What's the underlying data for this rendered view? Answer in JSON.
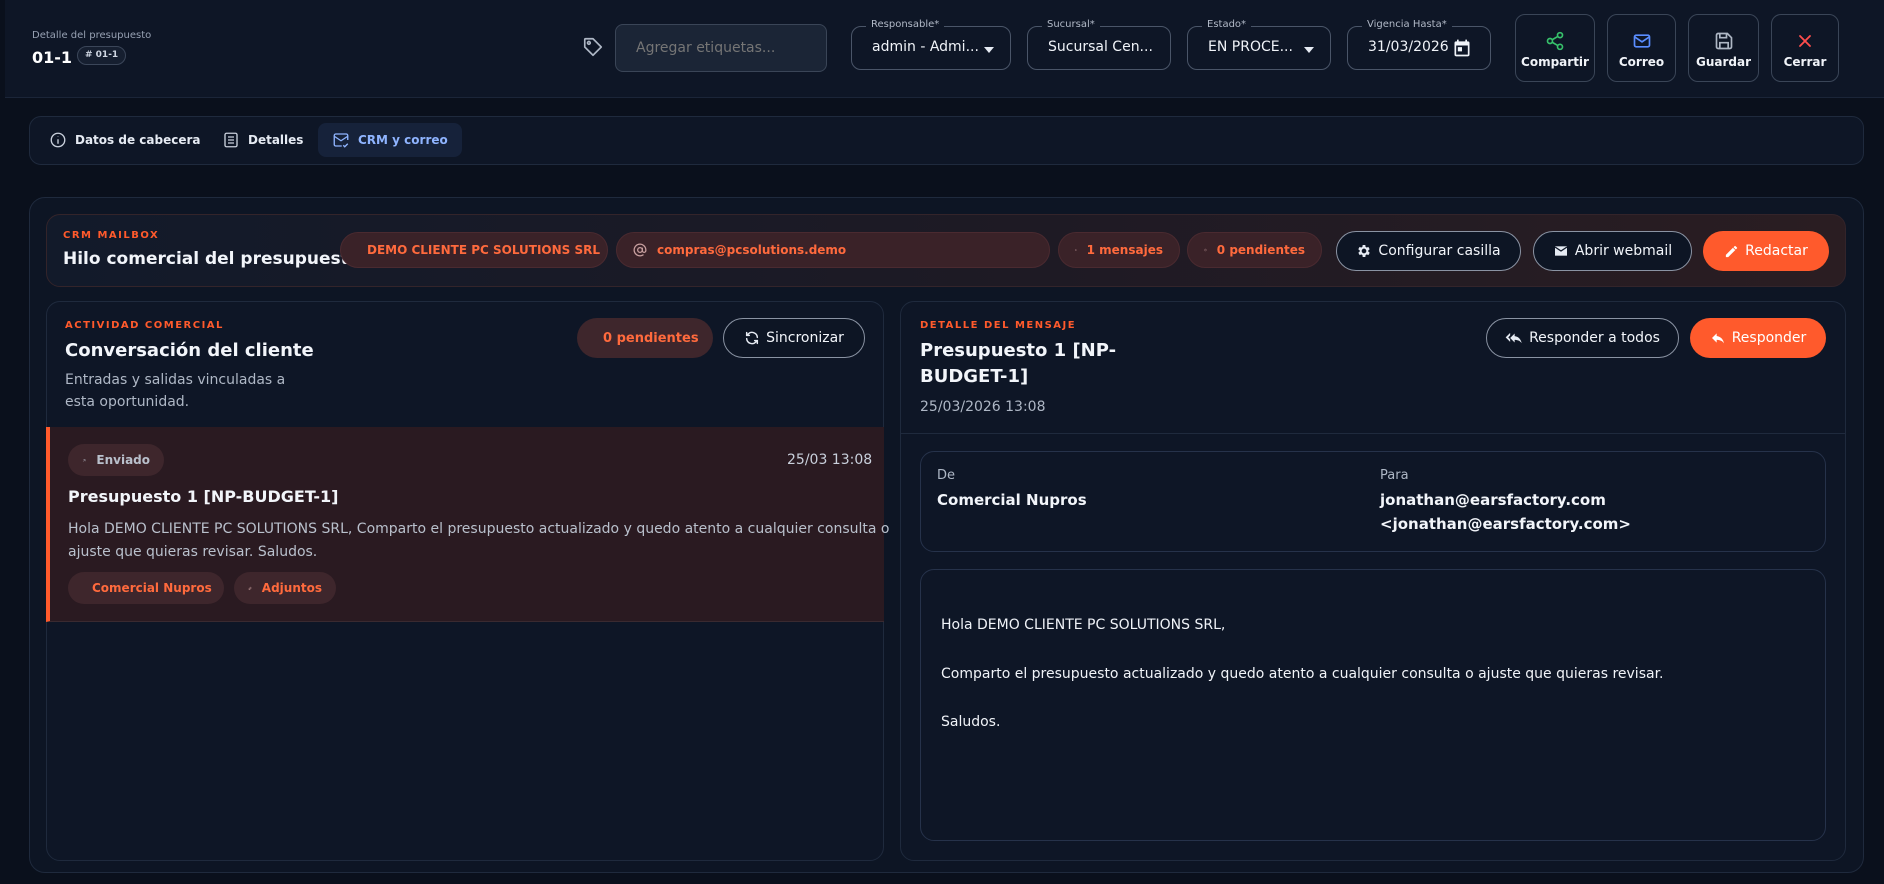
{
  "header": {
    "subtitle": "Detalle del presupuesto",
    "doc_id": "01-1",
    "doc_badge": "# 01-1",
    "tags_placeholder": "Agregar etiquetas...",
    "fields": {
      "responsable": {
        "label": "Responsable*",
        "value": "admin - Admi..."
      },
      "sucursal": {
        "label": "Sucursal*",
        "value": "Sucursal Cen..."
      },
      "estado": {
        "label": "Estado*",
        "value": "EN PROCE..."
      },
      "vigencia": {
        "label": "Vigencia Hasta*",
        "value": "31/03/2026"
      }
    },
    "actions": {
      "share": "Compartir",
      "mail": "Correo",
      "save": "Guardar",
      "close": "Cerrar"
    }
  },
  "tabs": {
    "header_data": "Datos de cabecera",
    "details": "Detalles",
    "crm": "CRM y correo"
  },
  "mailbox": {
    "kicker": "CRM MAILBOX",
    "title": "Hilo comercial del presupuesto",
    "client": "DEMO CLIENTE PC SOLUTIONS SRL",
    "email": "compras@pcsolutions.demo",
    "messages": "1 mensajes",
    "pending": "0 pendientes",
    "configure": "Configurar casilla",
    "webmail": "Abrir webmail",
    "compose": "Redactar"
  },
  "activity": {
    "kicker": "ACTIVIDAD COMERCIAL",
    "title": "Conversación del cliente",
    "description_line1": "Entradas y salidas vinculadas a",
    "description_line2": "esta oportunidad.",
    "pending": "0 pendientes",
    "sync": "Sincronizar",
    "items": [
      {
        "status": "Enviado",
        "date": "25/03 13:08",
        "subject": "Presupuesto 1 [NP-BUDGET-1]",
        "preview_line1": "Hola DEMO CLIENTE PC SOLUTIONS SRL, Comparto el presupuesto actualizado y quedo atento a cualquier consulta o",
        "preview_line2": "ajuste que quieras revisar. Saludos.",
        "sender": "Comercial Nupros",
        "attachments": "Adjuntos"
      }
    ]
  },
  "detail": {
    "kicker": "DETALLE DEL MENSAJE",
    "title_line1": "Presupuesto 1 [NP-",
    "title_line2": "BUDGET-1]",
    "datetime": "25/03/2026 13:08",
    "reply_all": "Responder a todos",
    "reply": "Responder",
    "from_label": "De",
    "from_value": "Comercial Nupros",
    "to_label": "Para",
    "to_value_line1": "jonathan@earsfactory.com",
    "to_value_line2": "<jonathan@earsfactory.com>",
    "body": {
      "greeting": "Hola DEMO CLIENTE PC SOLUTIONS SRL,",
      "paragraph": "Comparto el presupuesto actualizado y quedo atento a cualquier consulta o ajuste que quieras revisar.",
      "closing": "Saludos."
    }
  },
  "colors": {
    "accent": "#ff5a2c",
    "background": "#0a101c",
    "tab_active": "#8fb4ff",
    "share_icon": "#37c26b",
    "mail_icon": "#5a8dff",
    "close_icon": "#ff4d4d"
  }
}
